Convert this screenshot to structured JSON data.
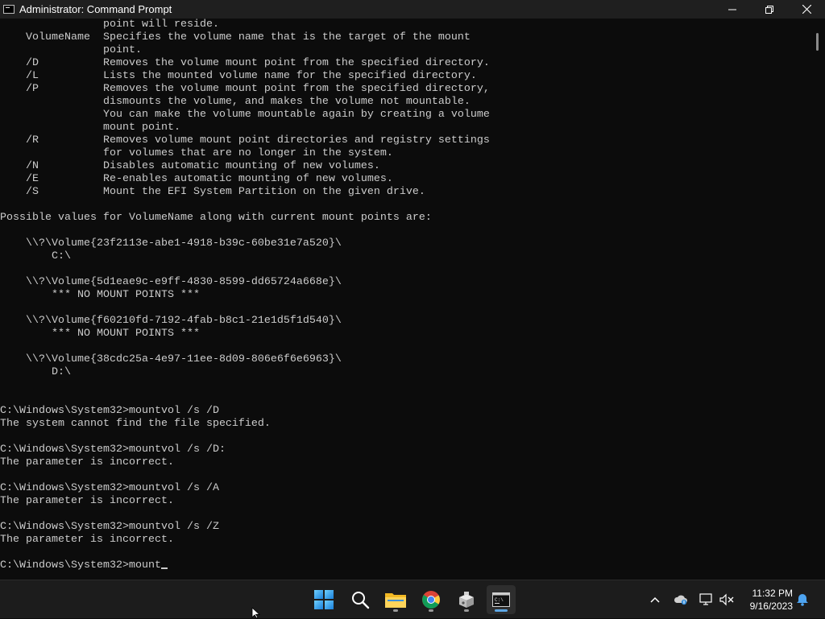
{
  "window": {
    "title": "Administrator: Command Prompt",
    "controls": [
      "minimize",
      "restore",
      "close"
    ]
  },
  "console": {
    "lines": [
      "                point will reside.",
      "    VolumeName  Specifies the volume name that is the target of the mount",
      "                point.",
      "    /D          Removes the volume mount point from the specified directory.",
      "    /L          Lists the mounted volume name for the specified directory.",
      "    /P          Removes the volume mount point from the specified directory,",
      "                dismounts the volume, and makes the volume not mountable.",
      "                You can make the volume mountable again by creating a volume",
      "                mount point.",
      "    /R          Removes volume mount point directories and registry settings",
      "                for volumes that are no longer in the system.",
      "    /N          Disables automatic mounting of new volumes.",
      "    /E          Re-enables automatic mounting of new volumes.",
      "    /S          Mount the EFI System Partition on the given drive.",
      "",
      "Possible values for VolumeName along with current mount points are:",
      "",
      "    \\\\?\\Volume{23f2113e-abe1-4918-b39c-60be31e7a520}\\",
      "        C:\\",
      "",
      "    \\\\?\\Volume{5d1eae9c-e9ff-4830-8599-dd65724a668e}\\",
      "        *** NO MOUNT POINTS ***",
      "",
      "    \\\\?\\Volume{f60210fd-7192-4fab-b8c1-21e1d5f1d540}\\",
      "        *** NO MOUNT POINTS ***",
      "",
      "    \\\\?\\Volume{38cdc25a-4e97-11ee-8d09-806e6f6e6963}\\",
      "        D:\\",
      "",
      "",
      "C:\\Windows\\System32>mountvol /s /D",
      "The system cannot find the file specified.",
      "",
      "C:\\Windows\\System32>mountvol /s /D:",
      "The parameter is incorrect.",
      "",
      "C:\\Windows\\System32>mountvol /s /A",
      "The parameter is incorrect.",
      "",
      "C:\\Windows\\System32>mountvol /s /Z",
      "The parameter is incorrect.",
      ""
    ],
    "prompt": "C:\\Windows\\System32>",
    "current_input": "mount"
  },
  "taskbar": {
    "apps": [
      {
        "name": "windows-start-icon",
        "active": false,
        "running": false
      },
      {
        "name": "search-icon",
        "active": false,
        "running": false
      },
      {
        "name": "file-explorer-icon",
        "active": false,
        "running": true
      },
      {
        "name": "chrome-icon",
        "active": false,
        "running": true
      },
      {
        "name": "installer-icon",
        "active": false,
        "running": true
      },
      {
        "name": "command-prompt-icon",
        "active": true,
        "running": true
      }
    ],
    "tray_icons": [
      "chevron-up-icon",
      "onedrive-icon",
      "network-icon",
      "volume-muted-icon"
    ],
    "clock": {
      "time": "11:32 PM",
      "date": "9/16/2023"
    },
    "notification_icon": "bell-icon"
  },
  "colors": {
    "console_bg": "#0c0c0c",
    "console_text": "#cccccc",
    "titlebar_bg": "#1f1f1f",
    "taskbar_bg": "#1c1c1c",
    "accent": "#5ea8e6"
  }
}
